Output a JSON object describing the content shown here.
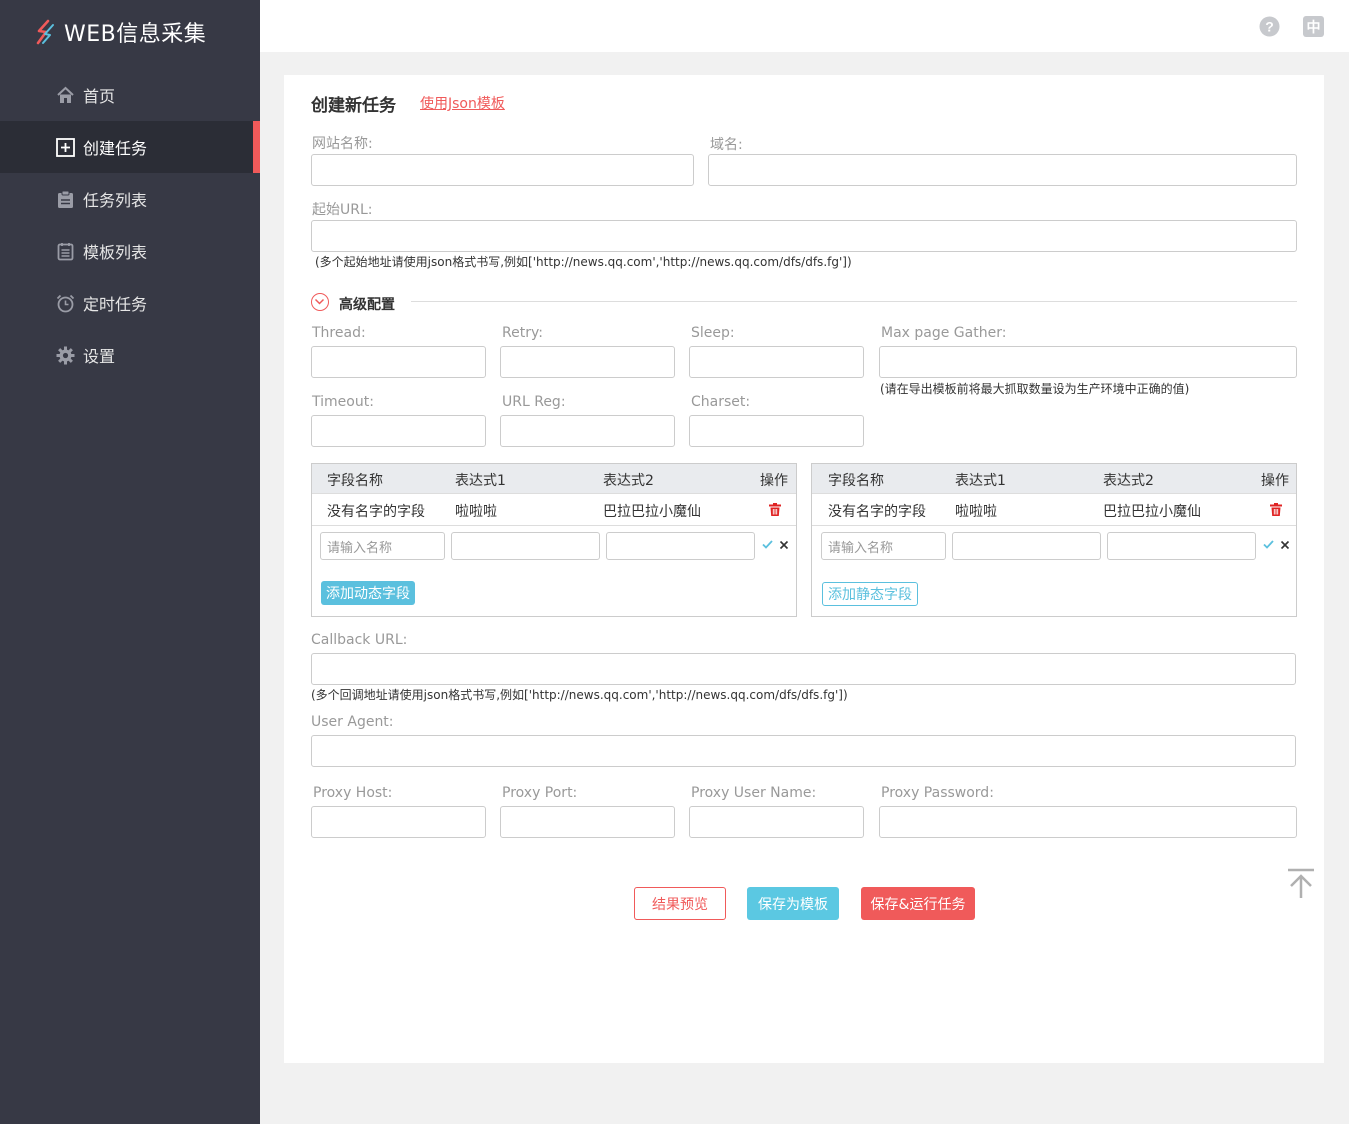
{
  "app": {
    "title": "WEB信息采集"
  },
  "sidebar": {
    "items": [
      {
        "label": "首页"
      },
      {
        "label": "创建任务"
      },
      {
        "label": "任务列表"
      },
      {
        "label": "模板列表"
      },
      {
        "label": "定时任务"
      },
      {
        "label": "设置"
      }
    ],
    "active_index": 1
  },
  "topbar": {
    "help_icon": "question-circle-icon",
    "lang_icon_text": "中"
  },
  "form": {
    "title": "创建新任务",
    "json_template_link": "使用Json模板",
    "site_name_label": "网站名称:",
    "domain_label": "域名:",
    "start_url_label": "起始URL:",
    "start_url_hint": "(多个起始地址请使用json格式书写,例如['http://news.qq.com','http://news.qq.com/dfs/dfs.fg'])",
    "advanced_label": "高级配置",
    "thread_label": "Thread:",
    "retry_label": "Retry:",
    "sleep_label": "Sleep:",
    "max_page_label": "Max page Gather:",
    "max_page_hint": "(请在导出模板前将最大抓取数量设为生产环境中正确的值)",
    "timeout_label": "Timeout:",
    "url_reg_label": "URL Reg:",
    "charset_label": "Charset:",
    "callback_label": "Callback URL:",
    "callback_hint": "(多个回调地址请使用json格式书写,例如['http://news.qq.com','http://news.qq.com/dfs/dfs.fg'])",
    "user_agent_label": "User Agent:",
    "proxy_host_label": "Proxy Host:",
    "proxy_port_label": "Proxy Port:",
    "proxy_user_label": "Proxy User Name:",
    "proxy_pass_label": "Proxy Password:"
  },
  "dynamic_fields": {
    "headers": [
      "字段名称",
      "表达式1",
      "表达式2",
      "操作"
    ],
    "rows": [
      [
        "没有名字的字段",
        "啦啦啦",
        "巴拉巴拉小魔仙"
      ]
    ],
    "name_placeholder": "请输入名称",
    "add_button": "添加动态字段"
  },
  "static_fields": {
    "headers": [
      "字段名称",
      "表达式1",
      "表达式2",
      "操作"
    ],
    "rows": [
      [
        "没有名字的字段",
        "啦啦啦",
        "巴拉巴拉小魔仙"
      ]
    ],
    "name_placeholder": "请输入名称",
    "add_button": "添加静态字段"
  },
  "actions": {
    "preview": "结果预览",
    "save_template": "保存为模板",
    "save_run": "保存&运行任务"
  },
  "colors": {
    "sidebar_bg": "#373945",
    "accent_red": "#f05a5a",
    "accent_teal": "#5bc0de"
  }
}
